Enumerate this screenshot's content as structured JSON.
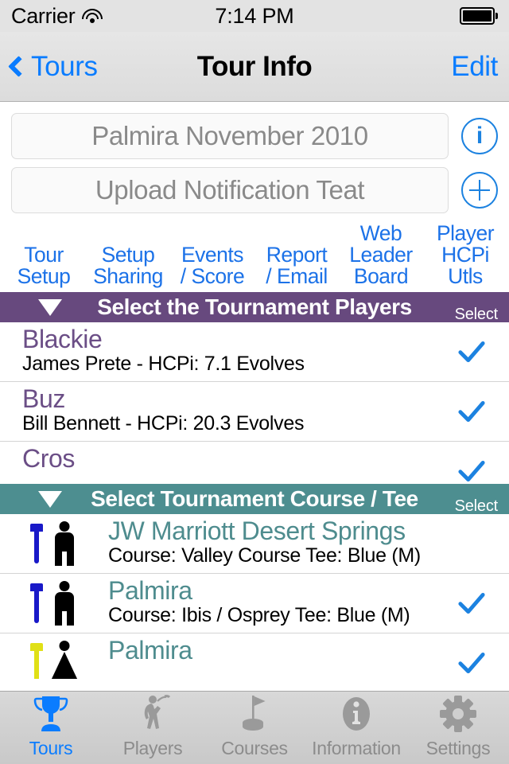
{
  "status_bar": {
    "carrier": "Carrier",
    "wifi_icon": "wifi-icon",
    "time": "7:14 PM",
    "battery_icon": "battery-full-icon"
  },
  "nav_bar": {
    "back_label": "Tours",
    "back_icon": "chevron-left-icon",
    "title": "Tour Info",
    "edit_label": "Edit"
  },
  "fields": [
    {
      "value": "Palmira November 2010",
      "button_icon": "info-circle-icon",
      "button_glyph": "i"
    },
    {
      "value": "Upload Notification Teat",
      "button_icon": "plus-circle-icon",
      "button_glyph": "+"
    }
  ],
  "tabs": [
    {
      "line1": "Tour",
      "line2": "Setup",
      "line3": ""
    },
    {
      "line1": "Setup",
      "line2": "Sharing",
      "line3": ""
    },
    {
      "line1": "Events",
      "line2": "/ Score",
      "line3": ""
    },
    {
      "line1": "Report",
      "line2": "/ Email",
      "line3": ""
    },
    {
      "line1": "Web",
      "line2": "Leader",
      "line3": "Board"
    },
    {
      "line1": "Player",
      "line2": "HCPi",
      "line3": "Utls"
    }
  ],
  "players_section": {
    "title": "Select the Tournament Players",
    "select_label": "Select",
    "disclosure_icon": "triangle-down-icon",
    "accent": "#67497e",
    "rows": [
      {
        "name": "Blackie",
        "detail": "James Prete - HCPi: 7.1 Evolves",
        "selected": true
      },
      {
        "name": "Buz",
        "detail": "Bill Bennett - HCPi: 20.3 Evolves",
        "selected": true
      },
      {
        "name": "Cros",
        "detail": "",
        "selected": true
      }
    ]
  },
  "courses_section": {
    "title": "Select Tournament Course / Tee",
    "select_label": "Select",
    "disclosure_icon": "triangle-down-icon",
    "accent": "#4d8e90",
    "rows": [
      {
        "name": "JW Marriott Desert Springs",
        "detail": "Course: Valley Course Tee: Blue (M)",
        "tee_color": "#1919c8",
        "gender": "male",
        "selected": false
      },
      {
        "name": "Palmira",
        "detail": "Course: Ibis / Osprey Tee: Blue (M)",
        "tee_color": "#1919c8",
        "gender": "male",
        "selected": true
      },
      {
        "name": "Palmira",
        "detail": "",
        "tee_color": "#e0e016",
        "gender": "female",
        "selected": true
      }
    ]
  },
  "tab_bar": {
    "items": [
      {
        "label": "Tours",
        "icon": "trophy-icon",
        "active": true
      },
      {
        "label": "Players",
        "icon": "golfer-icon",
        "active": false
      },
      {
        "label": "Courses",
        "icon": "flag-icon",
        "active": false
      },
      {
        "label": "Information",
        "icon": "info-circle-icon",
        "active": false
      },
      {
        "label": "Settings",
        "icon": "gear-icon",
        "active": false
      }
    ]
  },
  "colors": {
    "accent_blue": "#0a7cff",
    "purple": "#67497e",
    "teal": "#4d8e90",
    "player_name": "#6b4e86",
    "course_name": "#4e8c8e",
    "check_blue": "#1c82e0"
  }
}
